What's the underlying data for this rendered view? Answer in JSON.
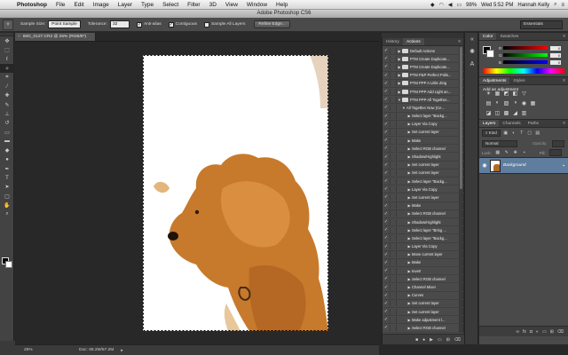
{
  "menubar": {
    "apple": "",
    "app_name": "Photoshop",
    "items": [
      "File",
      "Edit",
      "Image",
      "Layer",
      "Type",
      "Select",
      "Filter",
      "3D",
      "View",
      "Window",
      "Help"
    ],
    "clock": "Wed 5:52 PM",
    "user": "Hannah Kelly",
    "battery": "98%"
  },
  "window_title": "Adobe Photoshop CS6",
  "options": {
    "sample_size_label": "Sample Size:",
    "sample_size_value": "Point Sample",
    "tolerance_label": "Tolerance:",
    "tolerance_value": "32",
    "anti_alias_label": "Anti-alias",
    "contiguous_label": "Contiguous",
    "sample_all_layers_label": "Sample All Layers",
    "refine_edge_label": "Refine Edge...",
    "workspace": "Essentials"
  },
  "document": {
    "tab_title": "IMG_0127.CR2 @ 25% (RGB/8*)",
    "close_glyph": "×"
  },
  "status": {
    "zoom": "25%",
    "doc_size": "Doc: 68.2M/57.2M"
  },
  "actions_panel": {
    "tabs": [
      "History",
      "Actions"
    ],
    "active_tab": "Actions",
    "menu_glyph": "≡",
    "check_glyph": "✓",
    "items": [
      {
        "label": "Default Actions",
        "level": 0,
        "folder": true,
        "expanded": false
      },
      {
        "label": "PTM Create Duplicate...",
        "level": 0,
        "folder": true,
        "expanded": false
      },
      {
        "label": "PTM Create Duplicate...",
        "level": 0,
        "folder": true,
        "expanded": false
      },
      {
        "label": "PTM P&P Perfect Polis...",
        "level": 0,
        "folder": true,
        "expanded": false
      },
      {
        "label": "PTM PPP A Little Zing",
        "level": 0,
        "folder": true,
        "expanded": false
      },
      {
        "label": "PTM PPP Add Light an...",
        "level": 0,
        "folder": true,
        "expanded": false
      },
      {
        "label": "PTM PPP All Together...",
        "level": 0,
        "folder": true,
        "expanded": true
      },
      {
        "label": "All Together Now (Ce...",
        "level": 1,
        "folder": false,
        "expanded": true
      },
      {
        "label": "Select layer \"Backg...",
        "level": 2,
        "folder": false,
        "expanded": false
      },
      {
        "label": "Layer Via Copy",
        "level": 2,
        "folder": false,
        "expanded": false
      },
      {
        "label": "Set current layer",
        "level": 2,
        "folder": false,
        "expanded": false
      },
      {
        "label": "Make",
        "level": 2,
        "folder": false,
        "expanded": false
      },
      {
        "label": "Select RGB channel",
        "level": 2,
        "folder": false,
        "expanded": false
      },
      {
        "label": "Shadow/Highlight",
        "level": 2,
        "folder": false,
        "expanded": false
      },
      {
        "label": "Set current layer",
        "level": 2,
        "folder": false,
        "expanded": false
      },
      {
        "label": "Set current layer",
        "level": 2,
        "folder": false,
        "expanded": false
      },
      {
        "label": "Select layer \"Backg...",
        "level": 2,
        "folder": false,
        "expanded": false
      },
      {
        "label": "Layer Via Copy",
        "level": 2,
        "folder": false,
        "expanded": false
      },
      {
        "label": "Set current layer",
        "level": 2,
        "folder": false,
        "expanded": false
      },
      {
        "label": "Make",
        "level": 2,
        "folder": false,
        "expanded": false
      },
      {
        "label": "Select RGB channel",
        "level": 2,
        "folder": false,
        "expanded": false
      },
      {
        "label": "Shadow/Highlight",
        "level": 2,
        "folder": false,
        "expanded": false
      },
      {
        "label": "Select layer \"Bring ...",
        "level": 2,
        "folder": false,
        "expanded": false
      },
      {
        "label": "Select layer \"Backg...",
        "level": 2,
        "folder": false,
        "expanded": false
      },
      {
        "label": "Layer Via Copy",
        "level": 2,
        "folder": false,
        "expanded": false
      },
      {
        "label": "Move current layer",
        "level": 2,
        "folder": false,
        "expanded": false
      },
      {
        "label": "Make",
        "level": 2,
        "folder": false,
        "expanded": false
      },
      {
        "label": "Invert",
        "level": 2,
        "folder": false,
        "expanded": false
      },
      {
        "label": "Select RGB channel",
        "level": 2,
        "folder": false,
        "expanded": false
      },
      {
        "label": "Channel Mixer",
        "level": 2,
        "folder": false,
        "expanded": false
      },
      {
        "label": "Curves",
        "level": 2,
        "folder": false,
        "expanded": false
      },
      {
        "label": "Set current layer",
        "level": 2,
        "folder": false,
        "expanded": false
      },
      {
        "label": "Set current layer",
        "level": 2,
        "folder": false,
        "expanded": false
      },
      {
        "label": "Make adjustment l...",
        "level": 2,
        "folder": false,
        "expanded": false
      },
      {
        "label": "Select RGB channel",
        "level": 2,
        "folder": false,
        "expanded": false
      }
    ],
    "footer_icons": [
      "stop-icon",
      "record-icon",
      "play-icon",
      "new-set-icon",
      "new-action-icon",
      "delete-icon"
    ]
  },
  "color_panel": {
    "tabs": [
      "Color",
      "Swatches"
    ],
    "active_tab": "Color",
    "menu_glyph": "≡",
    "sliders": [
      {
        "label": "R",
        "value": "0",
        "color": "#ff0000"
      },
      {
        "label": "G",
        "value": "0",
        "color": "#00ff00"
      },
      {
        "label": "B",
        "value": "0",
        "color": "#0000ff"
      }
    ]
  },
  "adjustments_panel": {
    "tabs": [
      "Adjustments",
      "Styles"
    ],
    "active_tab": "Adjustments",
    "menu_glyph": "≡",
    "title": "Add an adjustment",
    "icons": [
      "☀",
      "▦",
      "◩",
      "◧",
      "▽",
      "",
      "",
      "",
      "▤",
      "◐",
      "▧",
      "◑",
      "◉",
      "▦",
      "",
      "",
      "◪",
      "◫",
      "▩",
      "◢",
      "▥",
      "",
      "",
      ""
    ]
  },
  "layers_panel": {
    "tabs": [
      "Layers",
      "Channels",
      "Paths"
    ],
    "active_tab": "Layers",
    "menu_glyph": "≡",
    "kind_filter": "⌕ Kind",
    "blend_mode": "Normal",
    "opacity_label": "Opacity:",
    "lock_label": "Lock:",
    "fill_label": "Fill:",
    "layer_name": "Background",
    "eye_glyph": "◉",
    "lock_glyph": "🔒",
    "footer_icons": [
      "link-icon",
      "fx-icon",
      "mask-icon",
      "adjustment-icon",
      "group-icon",
      "new-layer-icon",
      "trash-icon"
    ]
  },
  "tools": [
    {
      "name": "move-tool-icon",
      "glyph": "✥"
    },
    {
      "name": "marquee-tool-icon",
      "glyph": "⬚"
    },
    {
      "name": "lasso-tool-icon",
      "glyph": "ℓ"
    },
    {
      "name": "magic-wand-tool-icon",
      "glyph": "✧"
    },
    {
      "name": "crop-tool-icon",
      "glyph": "⌗"
    },
    {
      "name": "eyedropper-tool-icon",
      "glyph": "⁄"
    },
    {
      "name": "healing-brush-tool-icon",
      "glyph": "✚"
    },
    {
      "name": "brush-tool-icon",
      "glyph": "✎"
    },
    {
      "name": "clone-stamp-tool-icon",
      "glyph": "⊥"
    },
    {
      "name": "history-brush-tool-icon",
      "glyph": "↺"
    },
    {
      "name": "eraser-tool-icon",
      "glyph": "▭"
    },
    {
      "name": "gradient-tool-icon",
      "glyph": "▬"
    },
    {
      "name": "blur-tool-icon",
      "glyph": "◆"
    },
    {
      "name": "dodge-tool-icon",
      "glyph": "●"
    },
    {
      "name": "pen-tool-icon",
      "glyph": "✒"
    },
    {
      "name": "type-tool-icon",
      "glyph": "T"
    },
    {
      "name": "path-selection-tool-icon",
      "glyph": "➤"
    },
    {
      "name": "shape-tool-icon",
      "glyph": "▢"
    },
    {
      "name": "hand-tool-icon",
      "glyph": "✋"
    },
    {
      "name": "zoom-tool-icon",
      "glyph": "⌕"
    }
  ],
  "active_tool": "magic-wand-tool-icon"
}
